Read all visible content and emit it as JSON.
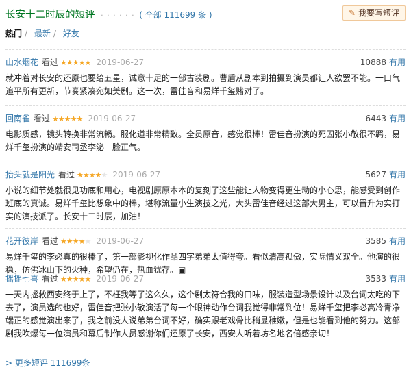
{
  "header": {
    "title": "长安十二时辰的短评",
    "dots": "· · · · · ·",
    "count": "( 全部 111699 条 )",
    "write_button": "我要写短评",
    "pen_icon": "pencil-icon"
  },
  "tabs": [
    {
      "label": "热门",
      "sep": "/"
    },
    {
      "label": "最新",
      "sep": "/"
    },
    {
      "label": "好友",
      "sep": ""
    }
  ],
  "reviews": [
    {
      "user": "山水烟花",
      "seen": "看过",
      "stars": 5,
      "date": "2019-06-27",
      "votes": "10888",
      "vote_label": "有用",
      "content": "就冲着对长安的还原也要给五星，诚意十足的一部古装剧。曹盾从剧本到拍摄到演员都让人欲罢不能。一口气追平所有更新，节奏紧凑宛如美剧。这一次，雷佳音和易烊千玺赌对了。"
    },
    {
      "user": "回南雀",
      "seen": "看过",
      "stars": 5,
      "date": "2019-06-27",
      "votes": "6443",
      "vote_label": "有用",
      "content": "电影质感，镜头转换非常流畅。服化道非常精致。全员原音，感觉很棒！雷佳音扮演的死囚张小敬很不羁，易烊千玺扮演的靖安司丞李泌一脸正气。"
    },
    {
      "user": "抬头就是阳光",
      "seen": "看过",
      "stars": 4,
      "date": "2019-06-27",
      "votes": "5627",
      "vote_label": "有用",
      "content": "小说的细节处就很见功底和用心，电视剧原原本本的复刻了这些能让人物变得更生动的小心思，能感受到创作班底的真诚。易烊千玺比想象中的棒，堪称流量小生演技之光，大头雷佳音经过这部大男主，可以晋升为实打实的演技派了。长安十二时辰，加油！"
    },
    {
      "user": "花开彼岸",
      "seen": "看过",
      "stars": 4,
      "date": "2019-06-27",
      "votes": "3585",
      "vote_label": "有用",
      "content": "易烊千玺的李必真的很棒了，第一部影视化作品四字弟弟太值得夸。看似清高孤傲，实际情义双全。他演的很稳，仿佛冰山下的火种，希望仍在，热血犹存。▣"
    },
    {
      "user": "摇摇七喜",
      "seen": "看过",
      "stars": 5,
      "date": "2019-06-27",
      "votes": "3533",
      "vote_label": "有用",
      "content": "一天内拯救西安终于上了，不枉我等了这么久，这个剧太符合我的口味，服装造型场景设计以及台词太吃的下去了，演员选的也好，雷佳音把张小敬演活了每一个眼神动作台词我觉得非常到位！易烊千玺把李必高冷青净端正的感觉演出来了，我之前没人说弟弟台词不好，确实跟老戏骨比稍显稚嫩，但是也能看到他的努力。这部剧我吹爆每一位演员和幕后制作人员感谢你们还原了长安，西安人听着坊名地名倍感亲切！"
    }
  ],
  "more_link": "> 更多短评 111699条",
  "colors": {
    "title_green": "#007722",
    "link_blue": "#3377aa",
    "star_orange": "#f5a623",
    "date_gray": "#aaaaaa",
    "button_bg": "#fff6e8"
  }
}
